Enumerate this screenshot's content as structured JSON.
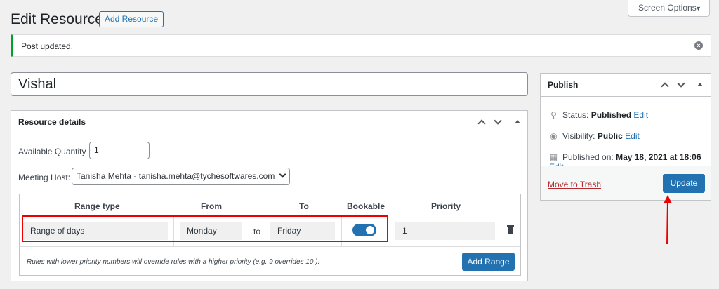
{
  "header": {
    "title": "Edit Resource",
    "add_button": "Add Resource",
    "screen_options": "Screen Options"
  },
  "notice": {
    "text": "Post updated."
  },
  "post": {
    "title": "Vishal"
  },
  "resource_details": {
    "title": "Resource details",
    "quantity_label": "Available Quantity :",
    "quantity_value": "1",
    "host_label": "Meeting Host:",
    "host_value": "Tanisha Mehta - tanisha.mehta@tychesoftwares.com",
    "columns": [
      "Range type",
      "From",
      "To",
      "Bookable",
      "Priority"
    ],
    "row": {
      "range_type": "Range of days",
      "from": "Monday",
      "to_word": "to",
      "to": "Friday",
      "bookable": true,
      "priority": "1"
    },
    "note": "Rules with lower priority numbers will override rules with a higher priority (e.g. 9 overrides 10 ).",
    "add_range": "Add Range"
  },
  "publish": {
    "title": "Publish",
    "status_label": "Status:",
    "status_value": "Published",
    "visibility_label": "Visibility:",
    "visibility_value": "Public",
    "published_label": "Published on:",
    "published_value": "May 18, 2021 at 18:06",
    "edit": "Edit",
    "trash_link": "Move to Trash",
    "update": "Update"
  },
  "colors": {
    "accent": "#2271b1",
    "success": "#00a32a",
    "annotation": "#e00000"
  }
}
